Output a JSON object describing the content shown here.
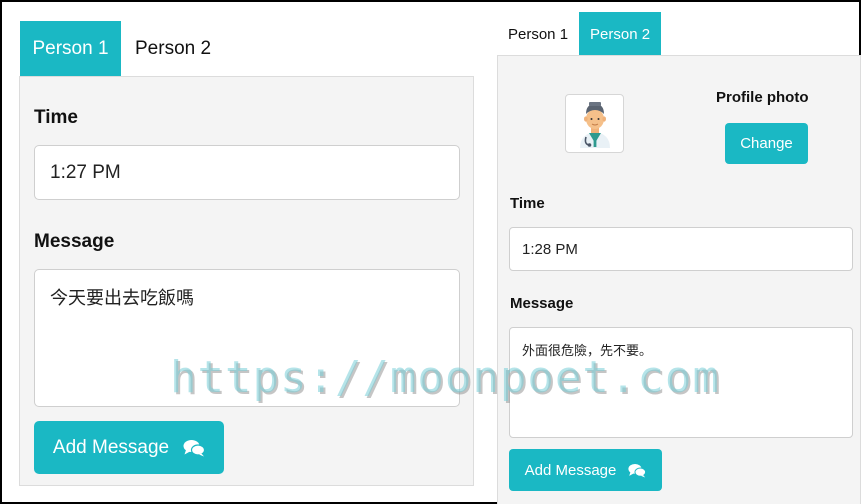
{
  "left_panel": {
    "tabs": [
      {
        "label": "Person 1",
        "active": true
      },
      {
        "label": "Person 2",
        "active": false
      }
    ],
    "time_label": "Time",
    "time_value": "1:27 PM",
    "message_label": "Message",
    "message_value": "今天要出去吃飯嗎",
    "add_button_label": "Add Message",
    "add_button_icon": "comments-icon"
  },
  "right_panel": {
    "tabs": [
      {
        "label": "Person 1",
        "active": false
      },
      {
        "label": "Person 2",
        "active": true
      }
    ],
    "avatar_icon": "doctor-avatar-icon",
    "profile_photo_label": "Profile photo",
    "change_button_label": "Change",
    "time_label": "Time",
    "time_value": "1:28 PM",
    "message_label": "Message",
    "message_value": "外面很危險，先不要。",
    "add_button_label": "Add Message",
    "add_button_icon": "comments-icon"
  },
  "watermark": "https://moonpoet.com",
  "colors": {
    "accent": "#1ab8c4",
    "panel_bg": "#f4f4f4"
  }
}
